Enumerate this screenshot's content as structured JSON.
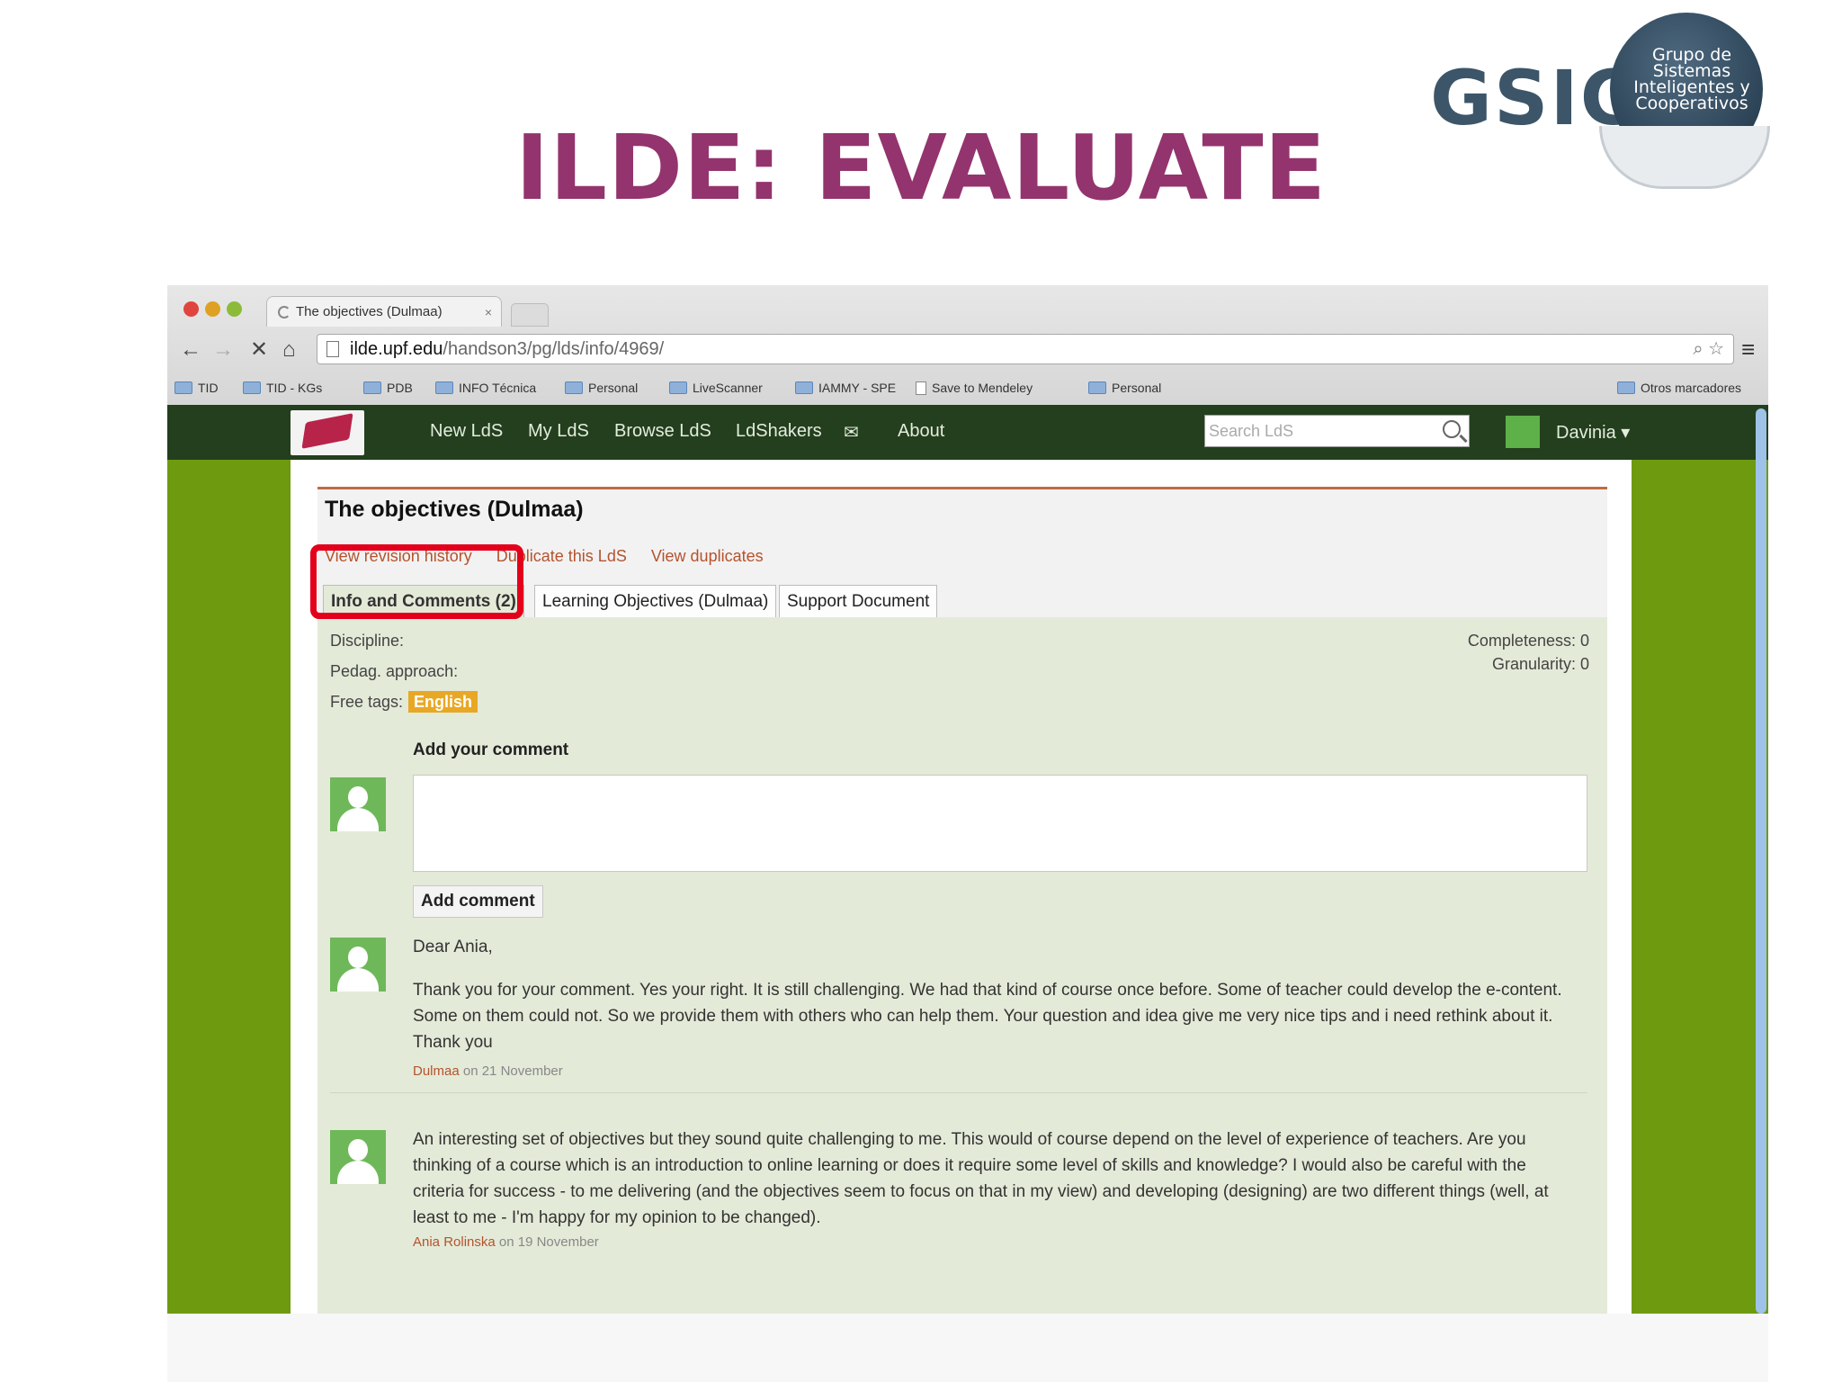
{
  "slide": {
    "title": "ILDE: EVALUATE",
    "logo_text": "GSIC",
    "logo_tagline": [
      "Grupo de",
      "Sistemas",
      "Inteligentes y",
      "Cooperativos"
    ]
  },
  "browser": {
    "tab_title": "The objectives (Dulmaa)",
    "tab_close": "×",
    "url_host": "ilde.upf.edu",
    "url_path": "/handson3/pg/lds/info/4969/",
    "nav_icons": [
      "back-icon",
      "forward-icon",
      "stop-icon",
      "home-icon"
    ],
    "bookmarks": [
      "TID",
      "TID - KGs",
      "PDB",
      "INFO Técnica",
      "Personal",
      "LiveScanner",
      "IAMMY - SPE",
      "Save to Mendeley",
      "Personal"
    ],
    "bookmarks_right": "Otros marcadores"
  },
  "site_nav": {
    "links": [
      "New LdS",
      "My LdS",
      "Browse LdS",
      "LdShakers",
      "About"
    ],
    "search_placeholder": "Search LdS",
    "user": "Davinia"
  },
  "lds": {
    "title": "The objectives (Dulmaa)",
    "actions": [
      "View revision history",
      "Duplicate this LdS",
      "View duplicates"
    ],
    "tabs": [
      "Info and Comments (2)",
      "Learning Objectives (Dulmaa)",
      "Support Document"
    ],
    "active_tab": 0,
    "discipline_label": "Discipline:",
    "pedag_label": "Pedag. approach:",
    "free_tags_label": "Free tags:",
    "free_tag": "English",
    "completeness": "Completeness: 0",
    "granularity": "Granularity: 0",
    "add_comment_label": "Add your comment",
    "add_comment_button": "Add comment",
    "comments": [
      {
        "greeting": "Dear Ania,",
        "text": "Thank you for your comment. Yes your right. It is still challenging. We had that kind of course once before. Some of teacher could develop the e-content. Some on them could not. So we provide them with others who can help them. Your question and idea give me very nice tips and i need rethink about it. Thank you",
        "author": "Dulmaa",
        "date": "on 21 November"
      },
      {
        "greeting": "",
        "text": "An interesting set of objectives but they sound quite challenging to me. This would of course depend on the level of experience of teachers. Are you thinking of a course which is an introduction to online learning or does it require some level of skills and knowledge? I would also be careful with the criteria for success - to me delivering (and the objectives seem to focus on that in my view) and developing (designing) are two different things (well, at least to me - I'm happy for my opinion to be changed).",
        "author": "Ania Rolinska",
        "date": "on 19 November"
      }
    ]
  },
  "colors": {
    "title": "#93346e",
    "nav_bg": "#233f1d",
    "page_bg": "#6e9a10",
    "panel": "#e4ead8",
    "link": "#b4532e",
    "tag": "#e8a825",
    "highlight": "#e3001b"
  }
}
